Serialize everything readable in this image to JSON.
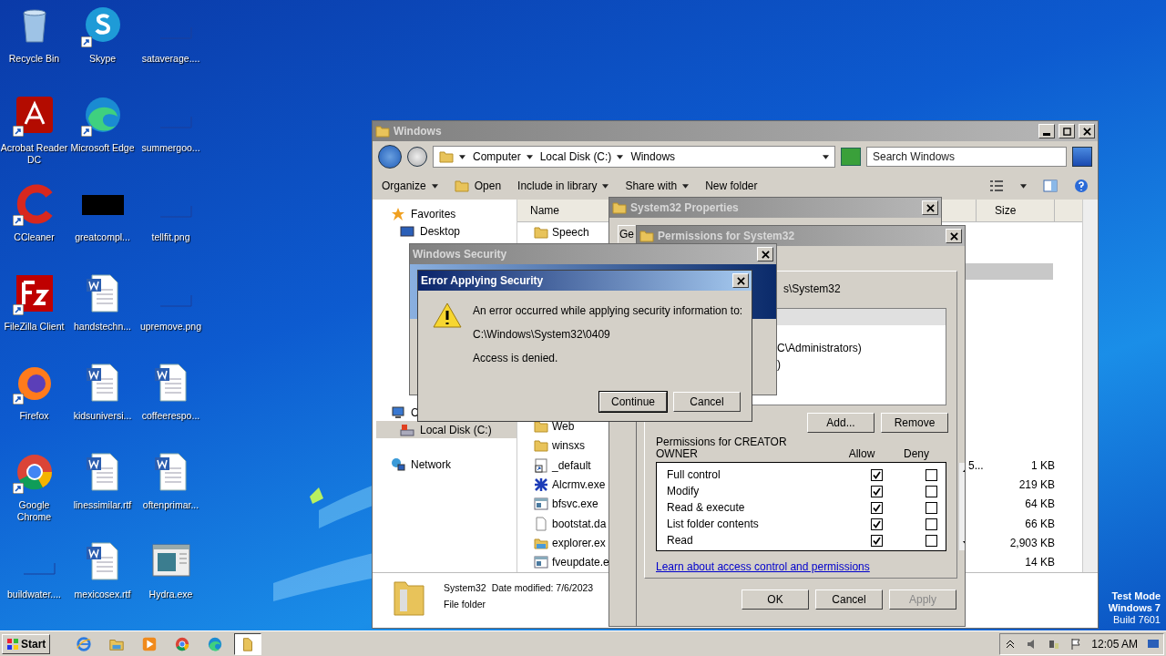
{
  "desktop_icons": [
    {
      "label": "Recycle Bin",
      "kind": "recycle",
      "shortcut": false
    },
    {
      "label": "Acrobat Reader DC",
      "kind": "acrobat",
      "shortcut": true
    },
    {
      "label": "CCleaner",
      "kind": "ccleaner",
      "shortcut": true
    },
    {
      "label": "FileZilla Client",
      "kind": "filezilla",
      "shortcut": true
    },
    {
      "label": "Firefox",
      "kind": "firefox",
      "shortcut": true
    },
    {
      "label": "Google Chrome",
      "kind": "chrome",
      "shortcut": true
    },
    {
      "label": "buildwater....",
      "kind": "blank",
      "shortcut": false
    },
    {
      "label": "Skype",
      "kind": "skype",
      "shortcut": true
    },
    {
      "label": "Microsoft Edge",
      "kind": "edge",
      "shortcut": true
    },
    {
      "label": "greatcompl...",
      "kind": "black",
      "shortcut": false
    },
    {
      "label": "handstechn...",
      "kind": "word",
      "shortcut": false
    },
    {
      "label": "kidsuniversi...",
      "kind": "word",
      "shortcut": false
    },
    {
      "label": "linessimilar.rtf",
      "kind": "word",
      "shortcut": false
    },
    {
      "label": "mexicosex.rtf",
      "kind": "word",
      "shortcut": false
    },
    {
      "label": "sataverage....",
      "kind": "blank",
      "shortcut": false
    },
    {
      "label": "summergoo...",
      "kind": "blank",
      "shortcut": false
    },
    {
      "label": "tellfit.png",
      "kind": "blank",
      "shortcut": false
    },
    {
      "label": "upremove.png",
      "kind": "blank",
      "shortcut": false
    },
    {
      "label": "coffeerespo...",
      "kind": "word",
      "shortcut": false
    },
    {
      "label": "oftenprimar...",
      "kind": "word",
      "shortcut": false
    },
    {
      "label": "Hydra.exe",
      "kind": "app",
      "shortcut": false
    }
  ],
  "explorer": {
    "title": "Windows",
    "breadcrumb": [
      "Computer",
      "Local Disk (C:)",
      "Windows"
    ],
    "search": {
      "placeholder": "Search Windows"
    },
    "toolbar": [
      {
        "label": "Organize",
        "kind": "menu"
      },
      {
        "label": "Open",
        "kind": "icon"
      },
      {
        "label": "Include in library",
        "kind": "menu"
      },
      {
        "label": "Share with",
        "kind": "menu"
      },
      {
        "label": "New folder",
        "kind": "plain"
      }
    ],
    "nav_top": [
      {
        "label": "Favorites",
        "kind": "star",
        "selected": false
      },
      {
        "label": "Desktop",
        "kind": "desktop",
        "selected": false
      }
    ],
    "nav_bottom": [
      {
        "label": "C",
        "kind": "computer",
        "selected": false
      },
      {
        "label": "Local Disk (C:)",
        "kind": "disk",
        "selected": true
      },
      {
        "label": "Network",
        "kind": "network",
        "selected": false
      }
    ],
    "columns": [
      "Name",
      "Size"
    ],
    "files_top": [
      {
        "name": "Speech",
        "kind": "folder"
      }
    ],
    "files_bottom": [
      {
        "name": "Web",
        "kind": "folder"
      },
      {
        "name": "winsxs",
        "kind": "folder"
      },
      {
        "name": "_default",
        "kind": "shortcut",
        "size": "1 KB",
        "column_3": "5..."
      },
      {
        "name": "Alcrmv.exe",
        "kind": "bug",
        "size": "219 KB"
      },
      {
        "name": "bfsvc.exe",
        "kind": "exe",
        "size": "64 KB"
      },
      {
        "name": "bootstat.da",
        "kind": "file",
        "size": "66 KB"
      },
      {
        "name": "explorer.ex",
        "kind": "explorer",
        "size": "2,903 KB"
      },
      {
        "name": "fveupdate.e",
        "kind": "exe",
        "size": "14 KB"
      }
    ],
    "details": {
      "name": "System32",
      "modified": "Date modified: 7/6/2023",
      "type": "File folder"
    }
  },
  "properties": {
    "title": "System32 Properties",
    "tab": "Ge"
  },
  "permissions": {
    "title": "Permissions for System32",
    "object_name": "s\\System32",
    "groups": [
      "C\\Administrators)",
      ")"
    ],
    "group_buttons": [
      "Add...",
      "Remove"
    ],
    "label": "Permissions for CREATOR OWNER",
    "allow_label": "Allow",
    "deny_label": "Deny",
    "entries": [
      {
        "name": "Full control",
        "allow": true,
        "deny": false
      },
      {
        "name": "Modify",
        "allow": true,
        "deny": false
      },
      {
        "name": "Read & execute",
        "allow": true,
        "deny": false
      },
      {
        "name": "List folder contents",
        "allow": true,
        "deny": false
      },
      {
        "name": "Read",
        "allow": true,
        "deny": false
      }
    ],
    "link": "Learn about access control and permissions",
    "buttons": [
      {
        "label": "OK",
        "disabled": false
      },
      {
        "label": "Cancel",
        "disabled": false
      },
      {
        "label": "Apply",
        "disabled": true
      }
    ]
  },
  "security": {
    "title": "Windows Security"
  },
  "error": {
    "title": "Error Applying Security",
    "message": "An error occurred while applying security information to:",
    "path": "C:\\Windows\\System32\\0409",
    "detail": "Access is denied.",
    "buttons": [
      {
        "label": "Continue",
        "default": true
      },
      {
        "label": "Cancel",
        "default": false
      }
    ]
  },
  "watermark_text": [
    "Test Mode",
    "Windows 7",
    "Build 7601"
  ],
  "taskbar": {
    "start": "Start",
    "apps": [
      {
        "kind": "ie",
        "selected": false
      },
      {
        "kind": "explorer",
        "selected": false
      },
      {
        "kind": "media",
        "selected": false
      },
      {
        "kind": "chrome",
        "selected": false
      },
      {
        "kind": "edge",
        "selected": false
      },
      {
        "kind": "folder",
        "selected": true
      }
    ],
    "time": "12:05 AM"
  }
}
